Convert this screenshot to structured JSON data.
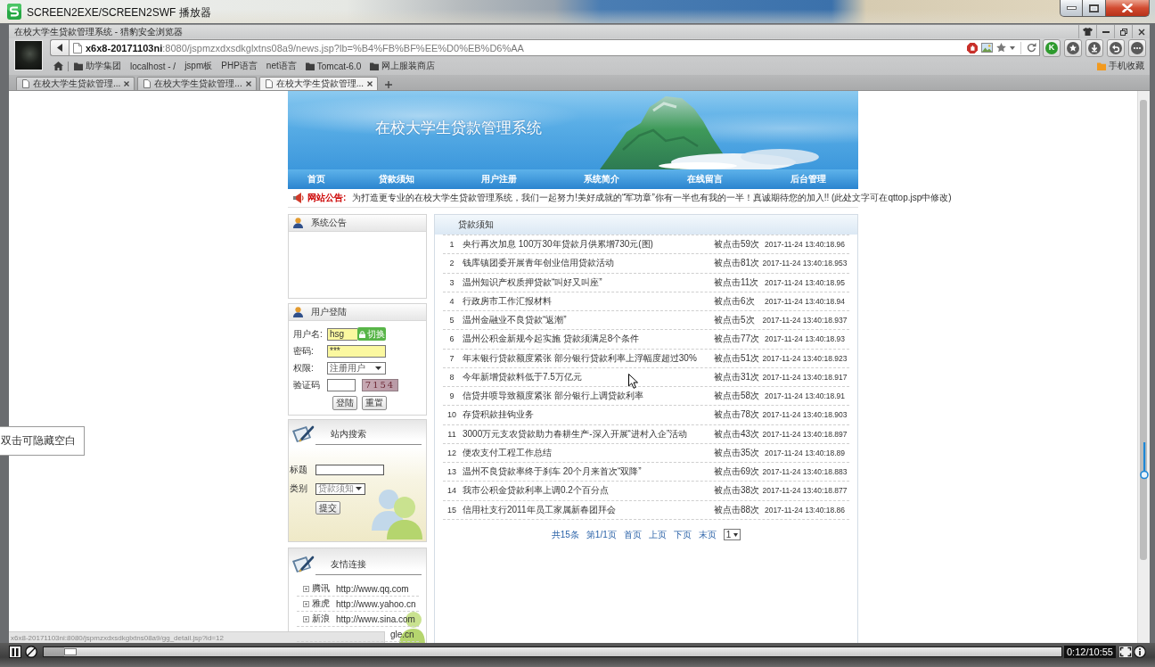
{
  "player": {
    "title": "SCREEN2EXE/SCREEN2SWF 播放器",
    "level": 0.02,
    "time": "0:12/10:55",
    "hint": "双击可隐藏空白"
  },
  "browser": {
    "title": "在校大学生贷款管理系统 - 猎豹安全浏览器",
    "address": "**x6x8-20171103ni**:8080/jspmzxdxsdkglxtns08a9/news.jsp?lb=%B4%FB%BF%EE%D0%EB%D6%AA",
    "extension_badge": "K",
    "bookmarks": [
      {
        "kind": "folder",
        "label": "助学集团"
      },
      {
        "kind": "link",
        "label": "localhost - /"
      },
      {
        "kind": "link",
        "label": "jspm板"
      },
      {
        "kind": "link",
        "label": "PHP语言"
      },
      {
        "kind": "link",
        "label": "net语言"
      },
      {
        "kind": "folder",
        "label": "Tomcat-6.0"
      },
      {
        "kind": "folder",
        "label": "网上服装商店"
      }
    ],
    "mobile_bookmarks": "手机收藏",
    "tabs": [
      {
        "label": "在校大学生贷款管理...",
        "selected": false
      },
      {
        "label": "在校大学生贷款管理...",
        "selected": false
      },
      {
        "label": "在校大学生贷款管理...",
        "selected": true
      }
    ],
    "status_url": "x6x8-20171103ni:8080/jspmzxdxsdkglxtns08a9/gg_detail.jsp?id=12"
  },
  "page": {
    "banner_title": "在校大学生贷款管理系统",
    "nav": [
      "首页",
      "贷款须知",
      "用户注册",
      "系统简介",
      "在线留言",
      "后台管理"
    ],
    "notice": {
      "label": "网站公告:",
      "text": "为打造更专业的在校大学生贷款管理系统，我们一起努力!美好成就的“军功章”你有一半也有我的一半！真诚期待您的加入!! (此处文字可在qttop.jsp中修改)"
    },
    "announcements": {
      "title": "系统公告"
    },
    "login": {
      "title": "用户登陆",
      "fields": [
        {
          "kind": "text",
          "label": "用户名:",
          "value": "hsg",
          "autofilled": true,
          "switch": "切换"
        },
        {
          "kind": "text",
          "label": "密码:",
          "value": "***",
          "autofilled": true
        },
        {
          "kind": "select",
          "label": "权限:",
          "value": "注册用户",
          "autofilled": false
        },
        {
          "kind": "captcha",
          "label": "验证码",
          "captcha": "7154",
          "autofilled": false
        }
      ],
      "buttons": [
        "登陆",
        "重置"
      ]
    },
    "search": {
      "title": "站内搜索",
      "fields": [
        {
          "kind": "text",
          "label": "标题"
        },
        {
          "kind": "select",
          "label": "类别",
          "value": "贷款须知"
        }
      ],
      "button": "提交"
    },
    "links": {
      "title": "友情连接",
      "items": [
        {
          "name": "腾讯",
          "url": "http://www.qq.com"
        },
        {
          "name": "雅虎",
          "url": "http://www.yahoo.cn"
        },
        {
          "name": "新浪",
          "url": "http://www.sina.com"
        },
        {
          "url": "gle.cn"
        }
      ]
    },
    "news": {
      "title": "贷款须知",
      "rows": [
        {
          "no": "1",
          "title": "央行再次加息 100万30年贷款月供累增730元(图)",
          "hits": "被点击59次",
          "date": "2017-11-24 13:40:18.96"
        },
        {
          "no": "2",
          "title": "钱库镇团委开展青年创业信用贷款活动",
          "hits": "被点击81次",
          "date": "2017-11-24 13:40:18.953"
        },
        {
          "no": "3",
          "title": "温州知识产权质押贷款“叫好又叫座”",
          "hits": "被点击11次",
          "date": "2017-11-24 13:40:18.95"
        },
        {
          "no": "4",
          "title": "行政房市工作汇报材料",
          "hits": "被点击6次",
          "date": "2017-11-24 13:40:18.94"
        },
        {
          "no": "5",
          "title": "温州金融业不良贷款“返潮”",
          "hits": "被点击5次",
          "date": "2017-11-24 13:40:18.937"
        },
        {
          "no": "6",
          "title": "温州公积金新规今起实施 贷款须满足8个条件",
          "hits": "被点击77次",
          "date": "2017-11-24 13:40:18.93"
        },
        {
          "no": "7",
          "title": "年末银行贷款额度紧张 部分银行贷款利率上浮幅度超过30%",
          "hits": "被点击51次",
          "date": "2017-11-24 13:40:18.923"
        },
        {
          "no": "8",
          "title": "今年新增贷款料低于7.5万亿元",
          "hits": "被点击31次",
          "date": "2017-11-24 13:40:18.917"
        },
        {
          "no": "9",
          "title": "信贷井喷导致额度紧张 部分银行上调贷款利率",
          "hits": "被点击58次",
          "date": "2017-11-24 13:40:18.91"
        },
        {
          "no": "10",
          "title": "存贷积款挂钩业务",
          "hits": "被点击78次",
          "date": "2017-11-24 13:40:18.903"
        },
        {
          "no": "11",
          "title": "3000万元支农贷款助力春耕生产-深入开展“进村入企”活动",
          "hits": "被点击43次",
          "date": "2017-11-24 13:40:18.897"
        },
        {
          "no": "12",
          "title": "便农支付工程工作总结",
          "hits": "被点击35次",
          "date": "2017-11-24 13:40:18.89"
        },
        {
          "no": "13",
          "title": "温州不良贷款率终于刹车 20个月来首次“双降”",
          "hits": "被点击69次",
          "date": "2017-11-24 13:40:18.883"
        },
        {
          "no": "14",
          "title": "我市公积金贷款利率上调0.2个百分点",
          "hits": "被点击38次",
          "date": "2017-11-24 13:40:18.877"
        },
        {
          "no": "15",
          "title": "信用社支行2011年员工家属新春团拜会",
          "hits": "被点击88次",
          "date": "2017-11-24 13:40:18.86"
        }
      ],
      "pagination": {
        "summary": [
          "共15条",
          "第1/1页"
        ],
        "links": [
          "首页",
          "上页",
          "下页",
          "末页"
        ],
        "page_select": "1"
      }
    }
  }
}
